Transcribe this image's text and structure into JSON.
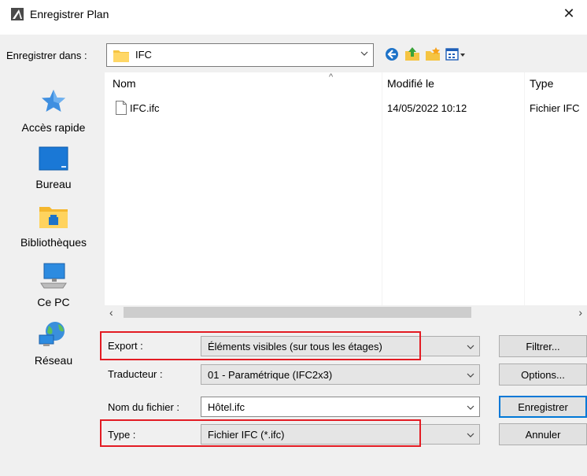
{
  "window": {
    "title": "Enregistrer Plan",
    "close_glyph": "✕"
  },
  "save_in": {
    "label": "Enregistrer dans :",
    "value": "IFC"
  },
  "toolbar": {
    "icons": [
      "back-icon",
      "up-folder-icon",
      "new-folder-icon",
      "view-menu-icon"
    ]
  },
  "places": [
    {
      "label": "Accès rapide",
      "icon": "quick-access-star-icon"
    },
    {
      "label": "Bureau",
      "icon": "desktop-icon"
    },
    {
      "label": "Bibliothèques",
      "icon": "libraries-icon"
    },
    {
      "label": "Ce PC",
      "icon": "this-pc-icon"
    },
    {
      "label": "Réseau",
      "icon": "network-icon"
    }
  ],
  "file_list": {
    "columns": {
      "name": "Nom",
      "modified": "Modifié le",
      "type": "Type"
    },
    "sort_indicator": "^",
    "rows": [
      {
        "name": "IFC.ifc",
        "modified": "14/05/2022 10:12",
        "type": "Fichier IFC"
      }
    ]
  },
  "scrollbar": {
    "left_arrow": "‹",
    "right_arrow": "›"
  },
  "form": {
    "export_label": "Export :",
    "export_value": "Éléments visibles (sur tous les étages)",
    "translator_label": "Traducteur :",
    "translator_value": "01 - Paramétrique (IFC2x3)",
    "filename_label": "Nom du fichier :",
    "filename_value": "Hôtel.ifc",
    "type_label": "Type :",
    "type_value": "Fichier IFC (*.ifc)"
  },
  "buttons": {
    "filter": "Filtrer...",
    "options": "Options...",
    "save": "Enregistrer",
    "cancel": "Annuler"
  },
  "colors": {
    "highlight": "#e31b23",
    "default_button_border": "#0078d7"
  }
}
